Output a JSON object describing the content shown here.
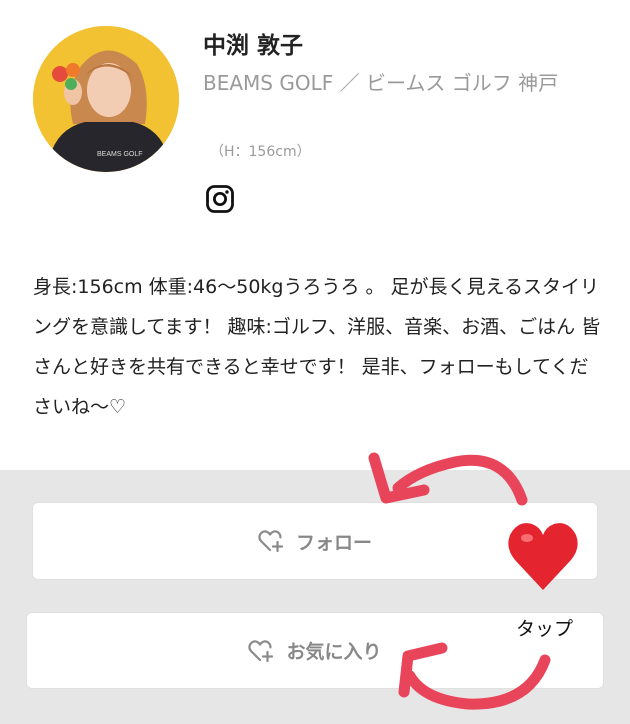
{
  "profile": {
    "name": "中渕 敦子",
    "shop": "BEAMS GOLF ／ ビームス ゴルフ 神戸",
    "height": "（H：156cm）",
    "avatar_shirt_text": "BEAMS GOLF",
    "social_icon": "instagram-icon"
  },
  "bio": "身長:156cm 体重:46〜50kgうろうろ 。 足が長く見えるスタイリングを意識してます！ 趣味:ゴルフ、洋服、音楽、お酒、ごはん 皆さんと好きを共有できると幸せです！ 是非、フォローもしてくださいね〜♡",
  "buttons": {
    "follow_label": "フォロー",
    "favorite_label": "お気に入り",
    "icon": "heart-plus-icon"
  },
  "annotation": {
    "tap_label": "タップ",
    "heart_emoji": "❤️",
    "arrow_color": "#e8455a",
    "heart_color": "#e4242e"
  }
}
